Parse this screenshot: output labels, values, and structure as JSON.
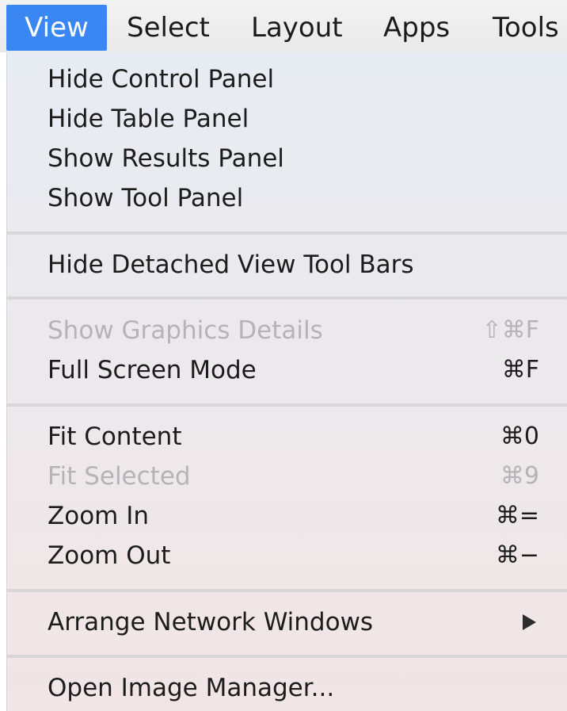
{
  "menubar": {
    "items": [
      {
        "label": "View",
        "active": true
      },
      {
        "label": "Select"
      },
      {
        "label": "Layout"
      },
      {
        "label": "Apps"
      },
      {
        "label": "Tools"
      }
    ]
  },
  "view_menu": {
    "items": [
      {
        "label": "Hide Control Panel",
        "shortcut": "",
        "enabled": true
      },
      {
        "label": "Hide Table Panel",
        "shortcut": "",
        "enabled": true
      },
      {
        "label": "Show Results Panel",
        "shortcut": "",
        "enabled": true
      },
      {
        "label": "Show Tool Panel",
        "shortcut": "",
        "enabled": true
      },
      {
        "label": "Hide Detached View Tool Bars",
        "shortcut": "",
        "enabled": true
      },
      {
        "label": "Show Graphics Details",
        "shortcut": "⇧⌘F",
        "enabled": false
      },
      {
        "label": "Full Screen Mode",
        "shortcut": "⌘F",
        "enabled": true
      },
      {
        "label": "Fit Content",
        "shortcut": "⌘0",
        "enabled": true
      },
      {
        "label": "Fit Selected",
        "shortcut": "⌘9",
        "enabled": false
      },
      {
        "label": "Zoom In",
        "shortcut": "⌘=",
        "enabled": true
      },
      {
        "label": "Zoom Out",
        "shortcut": "⌘−",
        "enabled": true
      },
      {
        "label": "Arrange Network Windows",
        "shortcut": "",
        "enabled": true,
        "submenu": true
      },
      {
        "label": "Open Image Manager...",
        "shortcut": "",
        "enabled": true
      }
    ]
  }
}
